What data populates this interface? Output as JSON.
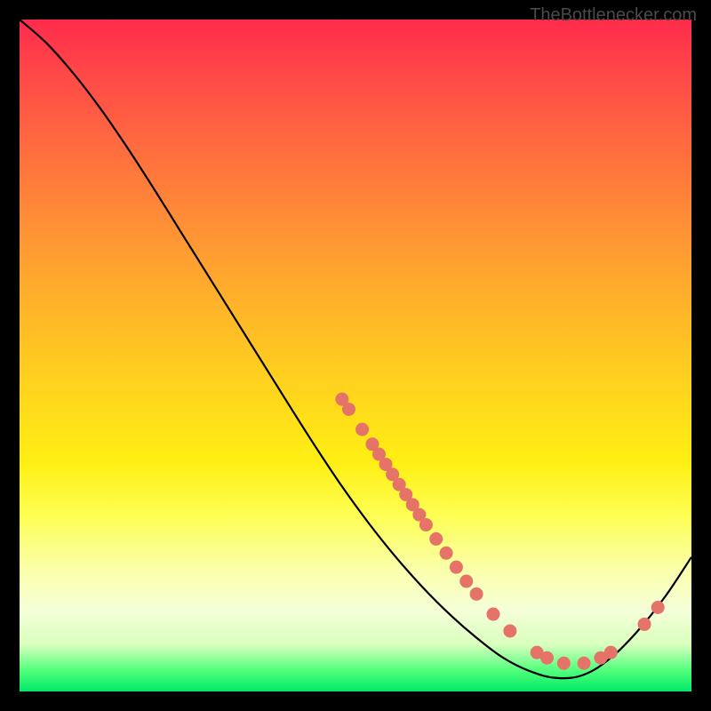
{
  "watermark": "TheBottlenecker.com",
  "chart_data": {
    "type": "line",
    "title": "",
    "xlabel": "",
    "ylabel": "",
    "xlim": [
      0,
      100
    ],
    "ylim": [
      0,
      100
    ],
    "grid": false,
    "curve": [
      {
        "x": 0.0,
        "y": 100.0
      },
      {
        "x": 4.0,
        "y": 96.5
      },
      {
        "x": 8.0,
        "y": 92.0
      },
      {
        "x": 12.0,
        "y": 86.8
      },
      {
        "x": 16.0,
        "y": 81.0
      },
      {
        "x": 20.0,
        "y": 74.8
      },
      {
        "x": 24.0,
        "y": 68.4
      },
      {
        "x": 28.0,
        "y": 62.0
      },
      {
        "x": 32.0,
        "y": 55.6
      },
      {
        "x": 36.0,
        "y": 49.2
      },
      {
        "x": 40.0,
        "y": 42.8
      },
      {
        "x": 44.0,
        "y": 36.5
      },
      {
        "x": 48.0,
        "y": 30.5
      },
      {
        "x": 52.0,
        "y": 25.0
      },
      {
        "x": 56.0,
        "y": 20.0
      },
      {
        "x": 60.0,
        "y": 15.5
      },
      {
        "x": 64.0,
        "y": 11.5
      },
      {
        "x": 68.0,
        "y": 8.0
      },
      {
        "x": 72.0,
        "y": 5.0
      },
      {
        "x": 76.0,
        "y": 3.0
      },
      {
        "x": 80.0,
        "y": 2.0
      },
      {
        "x": 84.0,
        "y": 2.5
      },
      {
        "x": 88.0,
        "y": 5.0
      },
      {
        "x": 92.0,
        "y": 9.0
      },
      {
        "x": 96.0,
        "y": 14.0
      },
      {
        "x": 100.0,
        "y": 20.0
      }
    ],
    "markers": [
      {
        "x": 48.0,
        "y": 43.5
      },
      {
        "x": 49.0,
        "y": 42.0
      },
      {
        "x": 51.0,
        "y": 39.0
      },
      {
        "x": 52.5,
        "y": 36.8
      },
      {
        "x": 53.5,
        "y": 35.3
      },
      {
        "x": 54.5,
        "y": 33.8
      },
      {
        "x": 55.5,
        "y": 32.3
      },
      {
        "x": 56.5,
        "y": 30.8
      },
      {
        "x": 57.5,
        "y": 29.3
      },
      {
        "x": 58.5,
        "y": 27.8
      },
      {
        "x": 59.5,
        "y": 26.3
      },
      {
        "x": 60.5,
        "y": 24.8
      },
      {
        "x": 62.0,
        "y": 22.7
      },
      {
        "x": 63.5,
        "y": 20.6
      },
      {
        "x": 65.0,
        "y": 18.5
      },
      {
        "x": 66.5,
        "y": 16.4
      },
      {
        "x": 68.0,
        "y": 14.5
      },
      {
        "x": 70.5,
        "y": 11.5
      },
      {
        "x": 73.0,
        "y": 9.0
      },
      {
        "x": 77.0,
        "y": 5.8
      },
      {
        "x": 78.5,
        "y": 5.0
      },
      {
        "x": 81.0,
        "y": 4.2
      },
      {
        "x": 84.0,
        "y": 4.2
      },
      {
        "x": 86.5,
        "y": 5.0
      },
      {
        "x": 88.0,
        "y": 5.8
      },
      {
        "x": 93.0,
        "y": 10.0
      },
      {
        "x": 95.0,
        "y": 12.5
      }
    ],
    "marker_color": "#e57368",
    "line_color": "#000000"
  }
}
